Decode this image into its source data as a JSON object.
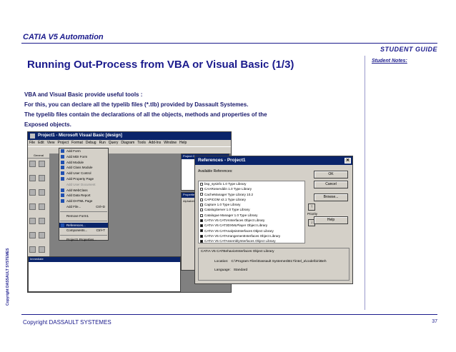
{
  "header": {
    "title": "CATIA V5 Automation",
    "student_guide": "STUDENT GUIDE",
    "student_notes": "Student Notes:"
  },
  "slide": {
    "title": "Running Out-Process from VBA or Visual Basic (1/3)",
    "lines": [
      "VBA and Visual Basic provide useful tools :",
      "For this, you can declare all the typelib files (*.tlb) provided by Dassault Systemes.",
      "The typelib files contain the declarations of all the objects, methods and properties of the",
      "Exposed objects."
    ]
  },
  "vb": {
    "title": "Project1 - Microsoft Visual Basic [design]",
    "menu": [
      "File",
      "Edit",
      "View",
      "Project",
      "Format",
      "Debug",
      "Run",
      "Query",
      "Diagram",
      "Tools",
      "Add-Ins",
      "Window",
      "Help"
    ],
    "toolbox_header": "General",
    "project_header": "Project Gro",
    "properties_header": "Properties",
    "properties_tab": "Alphabetic",
    "immediate_header": "Immediate",
    "project_menu": [
      {
        "label": "Add Form"
      },
      {
        "label": "Add MDI Form"
      },
      {
        "label": "Add Module"
      },
      {
        "label": "Add Class Module"
      },
      {
        "label": "Add User Control"
      },
      {
        "label": "Add Property Page"
      },
      {
        "label": "Add User Document",
        "disabled": true
      },
      {
        "label": "Add WebClass"
      },
      {
        "label": "Add Data Report"
      },
      {
        "label": "Add DHTML Page"
      },
      {
        "label": "Add File...",
        "shortcut": "Ctrl+D"
      },
      {
        "label": "Remove Form1"
      },
      {
        "label": "References...",
        "selected": true
      },
      {
        "label": "Components...",
        "shortcut": "Ctrl+T"
      },
      {
        "label": "Project1 Properties..."
      }
    ]
  },
  "references": {
    "title": "References - Project1",
    "available_label": "Available References:",
    "items": [
      {
        "label": "bsp_sysinfo 1.0 Type Library",
        "checked": false
      },
      {
        "label": "CAARoseAddin 1.0 Type Library",
        "checked": false
      },
      {
        "label": "CacheManager Type Library 10.2",
        "checked": false
      },
      {
        "label": "CAPICOM v2.1 Type Library",
        "checked": false
      },
      {
        "label": "Capture 1.0 Type Library",
        "checked": false
      },
      {
        "label": "CatalogServer 1.0 Type Library",
        "checked": false
      },
      {
        "label": "Catalogue Manager 1.0 Type Library",
        "checked": false
      },
      {
        "label": "CATIA V5 CATIAInterfaces Object Library",
        "checked": true
      },
      {
        "label": "CATIA V5 CAT3DXMLPlayer Object Library",
        "checked": true
      },
      {
        "label": "CATIA V5 CATAnalysisInterfaces Object Library",
        "checked": true
      },
      {
        "label": "CATIA V5 CATArrangementInterfaces Object Library",
        "checked": true
      },
      {
        "label": "CATIA V5 CATAssemblyInterfaces Object Library",
        "checked": true
      },
      {
        "label": "CATIA V5 CATBehaviorInterfaces Object Library",
        "checked": true,
        "selected": true
      },
      {
        "label": "CATIA V5 CATDataExchInterfaces Object Library",
        "checked": true
      }
    ],
    "buttons": {
      "ok": "OK",
      "cancel": "Cancel",
      "browse": "Browse...",
      "help": "Help"
    },
    "priority": "Priority",
    "info_title": "CATIA V5 CATBehaviorInterfaces Object Library",
    "location_label": "Location:",
    "location_value": "C:\\Program Files\\Dassault Systemes\\B17\\intel_a\\code\\bin\\Beh",
    "language_label": "Language:",
    "language_value": "Standard"
  },
  "footer": {
    "copyright": "Copyright DASSAULT SYSTEMES",
    "page": "37",
    "vertical": "Copyright DASSAULT SYSTEMES"
  }
}
